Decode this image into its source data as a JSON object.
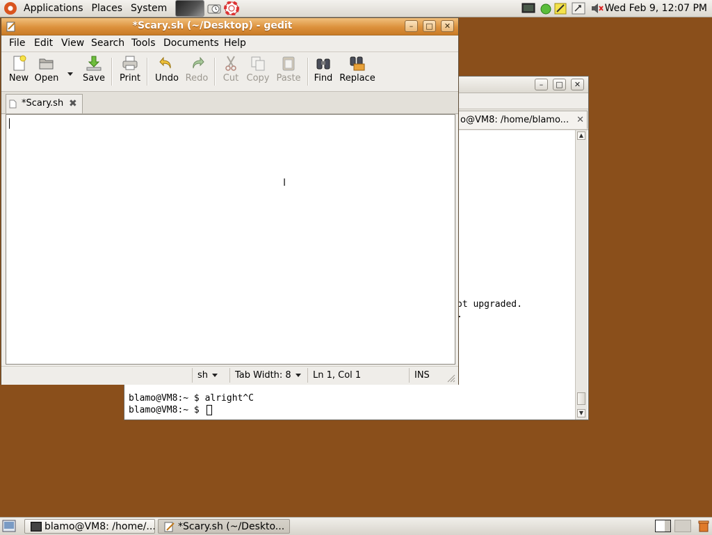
{
  "top_panel": {
    "menus": [
      "Applications",
      "Places",
      "System"
    ],
    "clock": "Wed Feb  9, 12:07 PM"
  },
  "terminal_window": {
    "tab_title": "o@VM8: /home/blamo...",
    "lines": [
      {
        "text": "ot upgraded."
      },
      {
        "text": "."
      },
      {
        "text": "blamo@VM8:~ $ alright^C"
      },
      {
        "text": "blamo@VM8:~ $ "
      }
    ]
  },
  "gedit_window": {
    "title": "*Scary.sh (~/Desktop) - gedit",
    "menus": [
      "File",
      "Edit",
      "View",
      "Search",
      "Tools",
      "Documents",
      "Help"
    ],
    "toolbar": {
      "new": "New",
      "open": "Open",
      "save": "Save",
      "print": "Print",
      "undo": "Undo",
      "redo": "Redo",
      "cut": "Cut",
      "copy": "Copy",
      "paste": "Paste",
      "find": "Find",
      "replace": "Replace"
    },
    "tab_label": "*Scary.sh",
    "status": {
      "language": "sh",
      "tab_width": "Tab Width: 8",
      "position": "Ln 1, Col 1",
      "mode": "INS"
    }
  },
  "taskbar": {
    "items": [
      {
        "label": "blamo@VM8: /home/..."
      },
      {
        "label": "*Scary.sh (~/Deskto..."
      }
    ]
  },
  "colors": {
    "desktop": "#8a4f1b",
    "titlebar_active": "#dc913c"
  }
}
